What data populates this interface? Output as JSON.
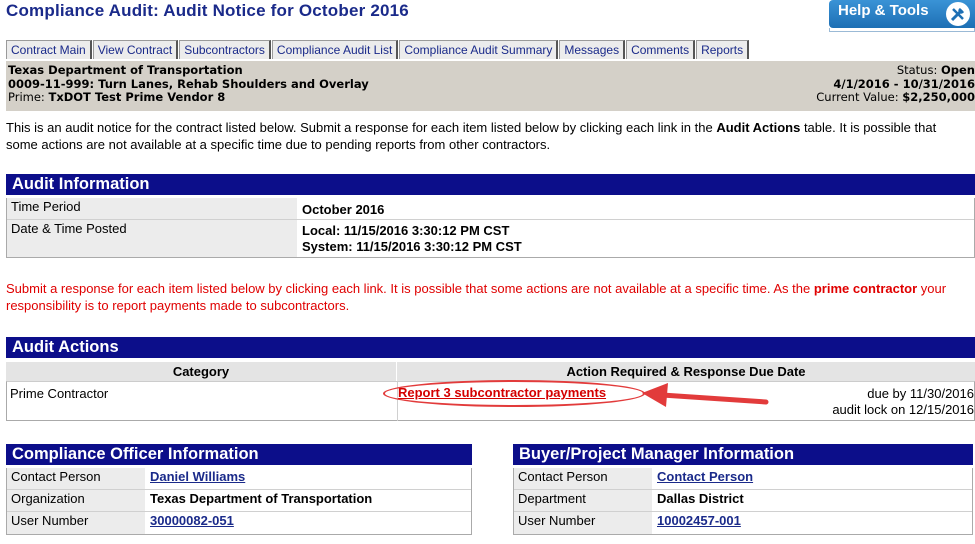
{
  "page": {
    "title": "Compliance Audit: Audit Notice for October 2016"
  },
  "help": {
    "label": "Help & Tools",
    "icon": "tools-icon"
  },
  "tabs": [
    {
      "label": "Contract Main"
    },
    {
      "label": "View Contract"
    },
    {
      "label": "Subcontractors"
    },
    {
      "label": "Compliance Audit List"
    },
    {
      "label": "Compliance Audit Summary"
    },
    {
      "label": "Messages"
    },
    {
      "label": "Comments"
    },
    {
      "label": "Reports"
    }
  ],
  "contract": {
    "agency": "Texas Department of Transportation",
    "name": "0009-11-999: Turn Lanes, Rehab Shoulders and Overlay",
    "prime_label": "Prime:",
    "prime": "TxDOT Test Prime Vendor 8",
    "status_label": "Status:",
    "status": "Open",
    "dates": "4/1/2016 - 10/31/2016",
    "value_label": "Current Value:",
    "value": "$2,250,000"
  },
  "intro": {
    "text1": "This is an audit notice for the contract listed below. Submit a response for each item listed below by clicking each link in the ",
    "bold": "Audit Actions",
    "text2": " table. It is possible that some actions are not available at a specific time due to pending reports from other contractors."
  },
  "audit_info": {
    "header": "Audit Information",
    "time_period_label": "Time Period",
    "time_period": "October 2016",
    "posted_label": "Date & Time Posted",
    "local": "Local: 11/15/2016 3:30:12 PM CST",
    "system": "System: 11/15/2016 3:30:12 PM CST"
  },
  "note": {
    "text1": "Submit a response for each item listed below by clicking each link. It is possible that some actions are not available at a specific time. As the ",
    "bold": "prime contractor",
    "text2": " your responsibility is to report payments made to subcontractors."
  },
  "audit_actions": {
    "header": "Audit Actions",
    "col_category": "Category",
    "col_action": "Action Required & Response Due Date",
    "category": "Prime Contractor",
    "action_link": "Report 3 subcontractor payments",
    "due": "due by 11/30/2016",
    "lock": "audit lock on 12/15/2016"
  },
  "compliance_officer": {
    "header": "Compliance Officer Information",
    "contact_label": "Contact Person",
    "contact": "Daniel Williams",
    "org_label": "Organization",
    "org": "Texas Department of Transportation",
    "user_label": "User Number",
    "user": "30000082-051"
  },
  "buyer": {
    "header": "Buyer/Project Manager Information",
    "contact_label": "Contact Person",
    "contact": "Contact Person",
    "dept_label": "Department",
    "dept": "Dallas District",
    "user_label": "User Number",
    "user": "10002457-001"
  },
  "colors": {
    "navy": "#0c0e8a",
    "link": "#1a2a8a",
    "alert": "#e00000",
    "annotation": "#e23b3b"
  }
}
